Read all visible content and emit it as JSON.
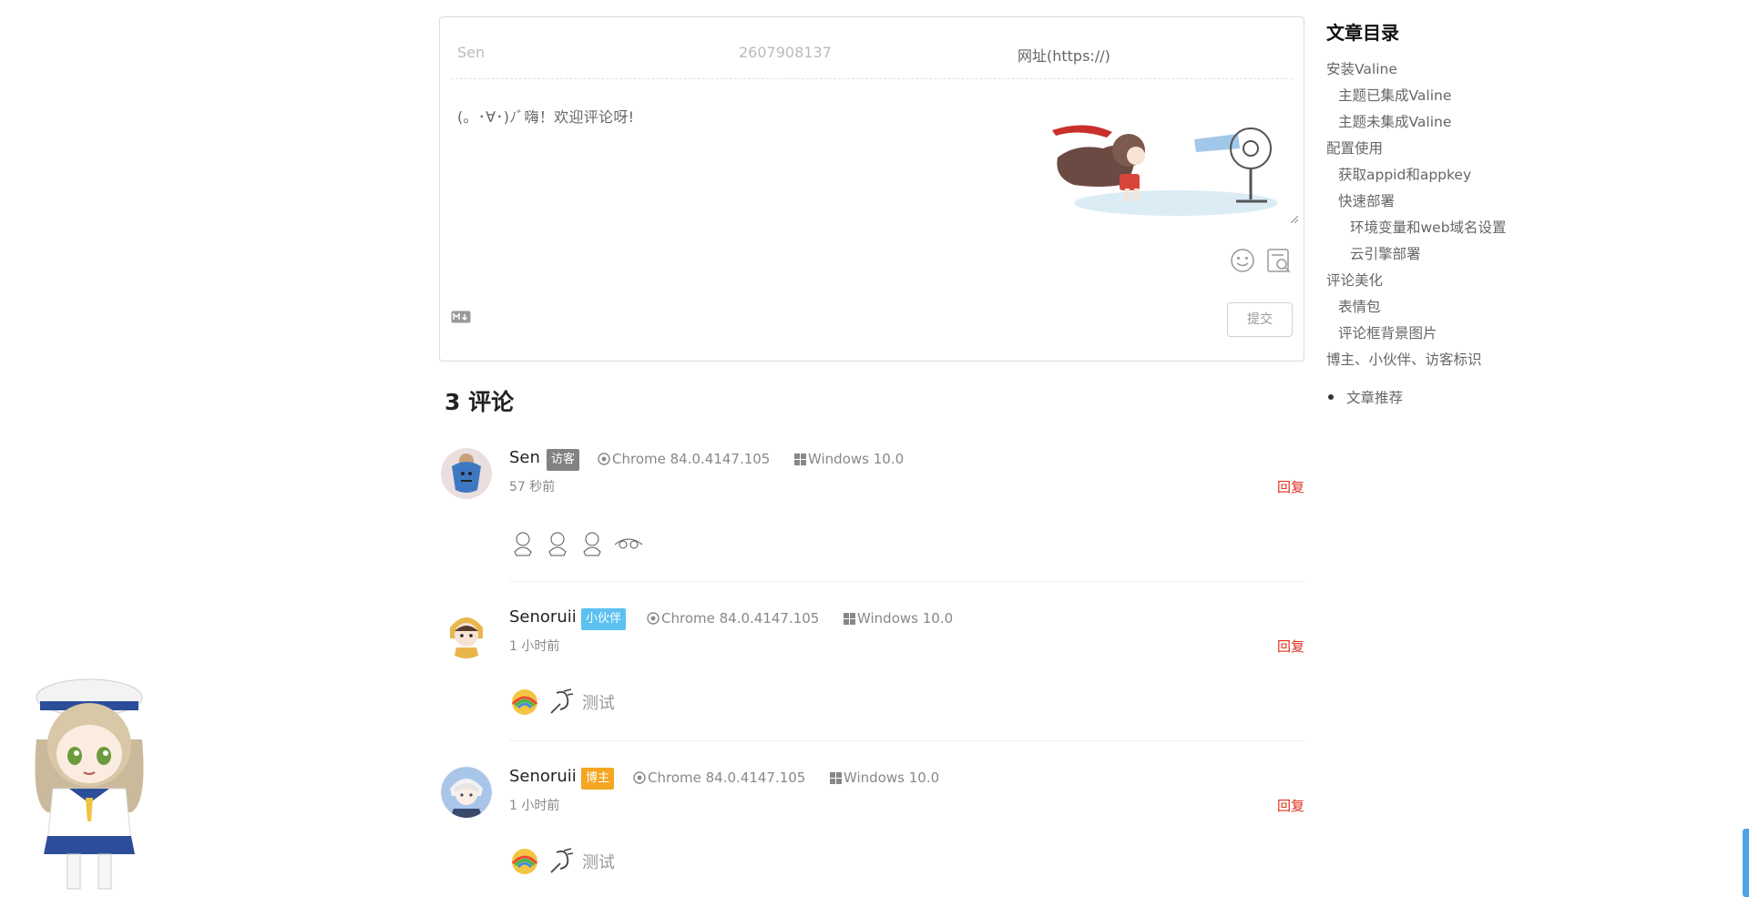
{
  "editor": {
    "nick_placeholder": "Sen",
    "mail_value": "2607908137",
    "url_placeholder": "网址(https://)",
    "content_placeholder": "(。･∀･)ﾉﾞ嗨！欢迎评论呀!",
    "submit_label": "提交",
    "emoji_icon": "smile-icon",
    "preview_icon": "preview-icon",
    "markdown_icon": "markdown-icon"
  },
  "comments_count": "3 评论",
  "comments": [
    {
      "nick": "Sen",
      "badge": "访客",
      "badge_color": "#828282",
      "browser": "Chrome 84.0.4147.105",
      "os": "Windows 10.0",
      "time": "57 秒前",
      "reply": "回复",
      "content_text": ""
    },
    {
      "nick": "Senoruii",
      "badge": "小伙伴",
      "badge_color": "#5cc1f0",
      "browser": "Chrome 84.0.4147.105",
      "os": "Windows 10.0",
      "time": "1 小时前",
      "reply": "回复",
      "content_text": "测试"
    },
    {
      "nick": "Senoruii",
      "badge": "博主",
      "badge_color": "#f5a623",
      "browser": "Chrome 84.0.4147.105",
      "os": "Windows 10.0",
      "time": "1 小时前",
      "reply": "回复",
      "content_text": "测试"
    }
  ],
  "toc": {
    "title": "文章目录",
    "items": [
      "安装Valine",
      "主题已集成Valine",
      "主题未集成Valine",
      "配置使用",
      "获取appid和appkey",
      "快速部署",
      "环境变量和web域名设置",
      "云引擎部署",
      "评论美化",
      "表情包",
      "评论框背景图片",
      "博主、小伙伴、访客标识",
      "文章推荐"
    ]
  }
}
